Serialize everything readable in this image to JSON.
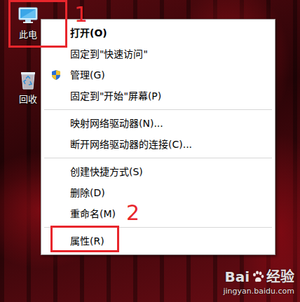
{
  "desktop_icons": [
    {
      "label": "此电"
    },
    {
      "label": "回收"
    }
  ],
  "menu": {
    "items": [
      {
        "kind": "default",
        "label": "打开(O)"
      },
      {
        "kind": "plain",
        "label": "固定到\"快速访问\""
      },
      {
        "kind": "icon",
        "label": "管理(G)"
      },
      {
        "kind": "plain",
        "label": "固定到\"开始\"屏幕(P)"
      },
      {
        "kind": "separator"
      },
      {
        "kind": "plain",
        "label": "映射网络驱动器(N)..."
      },
      {
        "kind": "plain",
        "label": "断开网络驱动器的连接(C)..."
      },
      {
        "kind": "separator"
      },
      {
        "kind": "plain",
        "label": "创建快捷方式(S)"
      },
      {
        "kind": "plain",
        "label": "删除(D)"
      },
      {
        "kind": "plain",
        "label": "重命名(M)"
      },
      {
        "kind": "separator"
      },
      {
        "kind": "plain",
        "label": "属性(R)"
      }
    ]
  },
  "annotations": [
    {
      "label": "1"
    },
    {
      "label": "2"
    }
  ],
  "watermark": {
    "brand": "Bai",
    "name": "经验",
    "url": "jingyan.baidu.com"
  }
}
